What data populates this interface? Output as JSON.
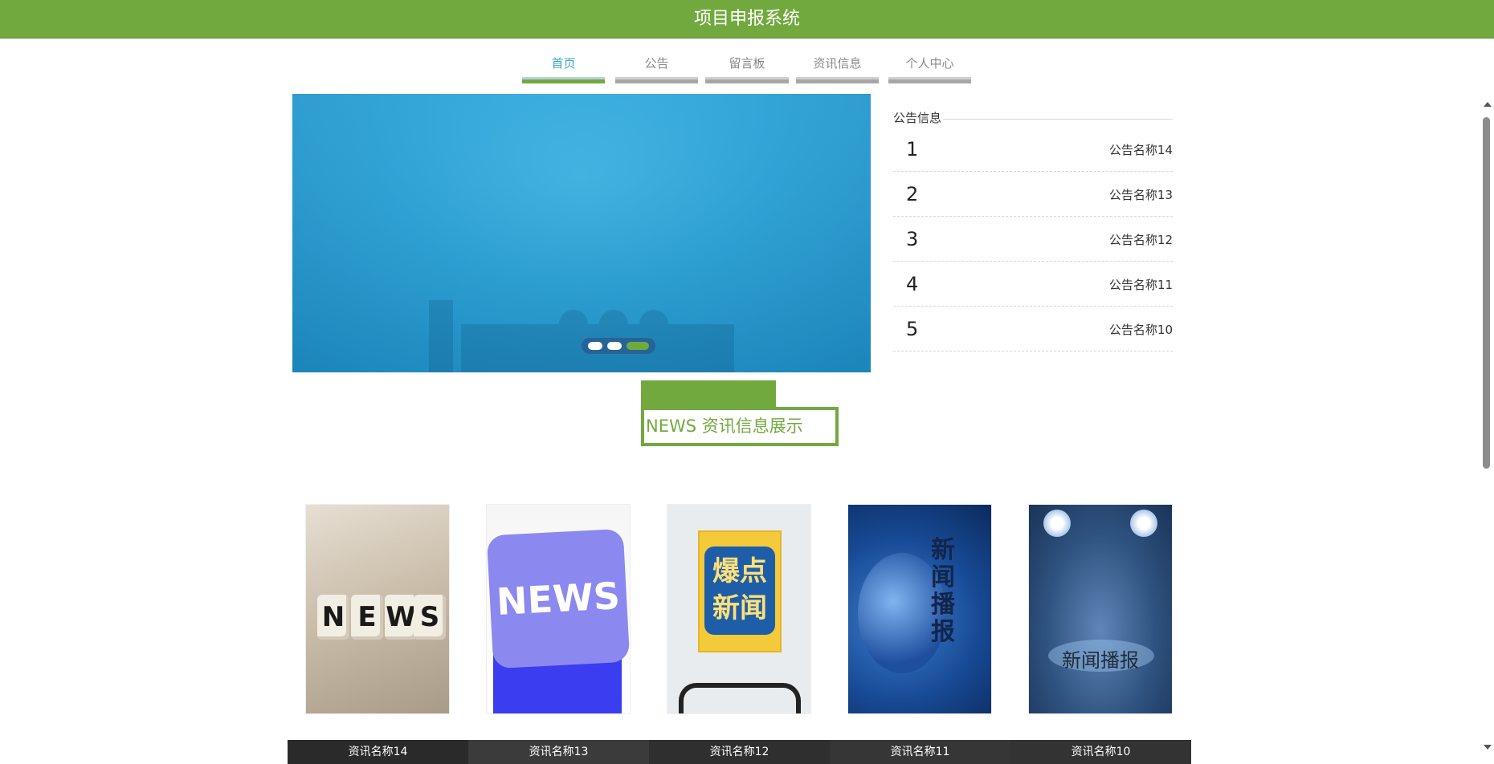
{
  "header": {
    "title": "项目申报系统"
  },
  "nav": {
    "items": [
      {
        "label": "首页",
        "active": true
      },
      {
        "label": "公告",
        "active": false
      },
      {
        "label": "留言板",
        "active": false
      },
      {
        "label": "资讯信息",
        "active": false
      },
      {
        "label": "个人中心",
        "active": false
      }
    ]
  },
  "carousel": {
    "slide_count": 3,
    "active_index": 2
  },
  "notice_panel": {
    "title": "公告信息",
    "items": [
      {
        "num": "1",
        "name": "公告名称14"
      },
      {
        "num": "2",
        "name": "公告名称13"
      },
      {
        "num": "3",
        "name": "公告名称12"
      },
      {
        "num": "4",
        "name": "公告名称11"
      },
      {
        "num": "5",
        "name": "公告名称10"
      }
    ]
  },
  "news_section": {
    "title": "NEWS 资讯信息展示",
    "cards": [
      {
        "image": "news-blocks-image",
        "image_text": "NEWS",
        "caption": "资讯名称14"
      },
      {
        "image": "news-key-image",
        "image_text": "NEWS",
        "caption": "资讯名称13"
      },
      {
        "image": "breaking-news-image",
        "image_text": "爆点新闻",
        "caption": "资讯名称12"
      },
      {
        "image": "globe-broadcast-image",
        "image_text": "新闻播报",
        "caption": "资讯名称11"
      },
      {
        "image": "spotlight-stage-image",
        "image_text": "新闻播报",
        "caption": "资讯名称10"
      }
    ]
  },
  "colors": {
    "brand": "#72a93f",
    "nav_active_text": "#3aa5c8",
    "nav_inactive": "#a7a7a7"
  }
}
